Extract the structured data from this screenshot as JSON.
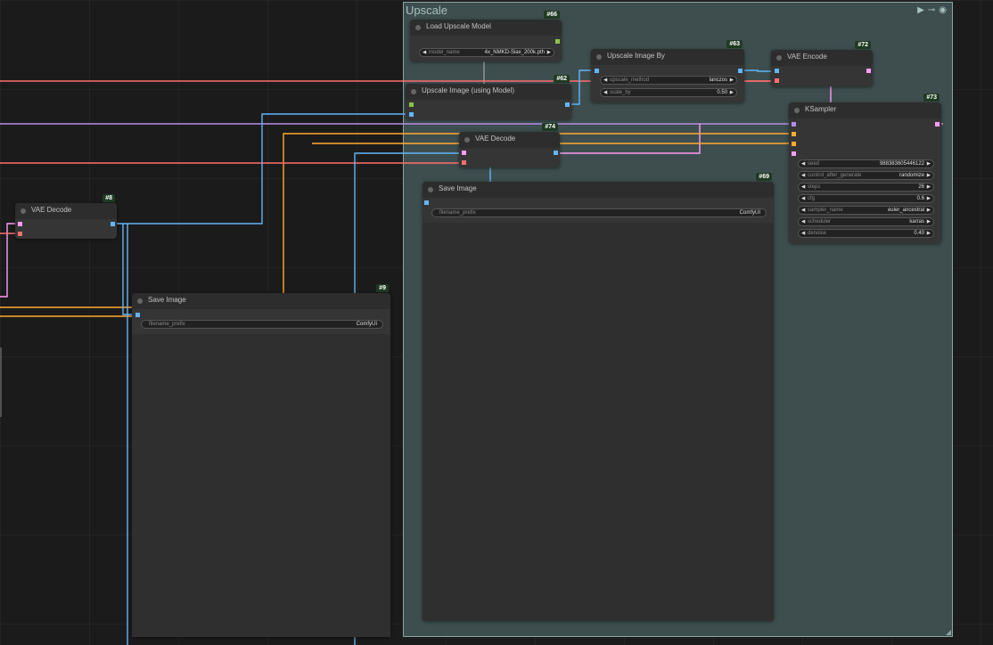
{
  "group": {
    "title": "Upscale"
  },
  "nodes": {
    "load_upscale_model": {
      "title": "Load Upscale Model",
      "id": "#66",
      "widgets": {
        "model_name": {
          "label": "model_name",
          "value": "4x_NMKD-Siax_200k.pth"
        }
      }
    },
    "upscale_image_by": {
      "title": "Upscale Image By",
      "id": "#63",
      "widgets": {
        "upscale_method": {
          "label": "upscale_method",
          "value": "lanczos"
        },
        "scale_by": {
          "label": "scale_by",
          "value": "0.50"
        }
      }
    },
    "vae_encode": {
      "title": "VAE Encode",
      "id": "#72"
    },
    "upscale_image_model": {
      "title": "Upscale Image (using Model)",
      "id": "#62"
    },
    "ksampler": {
      "title": "KSampler",
      "id": "#73",
      "widgets": {
        "seed": {
          "label": "seed",
          "value": "988383605446122"
        },
        "control_after_generate": {
          "label": "control_after_generate",
          "value": "randomize"
        },
        "steps": {
          "label": "steps",
          "value": "26"
        },
        "cfg": {
          "label": "cfg",
          "value": "0.6"
        },
        "sampler_name": {
          "label": "sampler_name",
          "value": "euler_ancestral"
        },
        "scheduler": {
          "label": "scheduler",
          "value": "karras"
        },
        "denoise": {
          "label": "denoise",
          "value": "0.40"
        }
      }
    },
    "vae_decode_74": {
      "title": "VAE Decode",
      "id": "#74"
    },
    "save_image_69": {
      "title": "Save Image",
      "id": "#69",
      "widgets": {
        "filename_prefix": {
          "label": "filename_prefix",
          "value": "ComfyUI"
        }
      }
    },
    "vae_decode_8": {
      "title": "VAE Decode",
      "id": "#8"
    },
    "save_image_9": {
      "title": "Save Image",
      "id": "#9",
      "widgets": {
        "filename_prefix": {
          "label": "filename_prefix",
          "value": "ComfyUI"
        }
      }
    }
  },
  "colors": {
    "image": "#64b5f6",
    "latent": "#ff9cf9",
    "vae": "#ff6e6e",
    "upscale_model": "#b39ddb",
    "conditioning": "#ffa931",
    "upscale_model_slot": "#8bc34a",
    "link_purple": "#b48ee8"
  }
}
